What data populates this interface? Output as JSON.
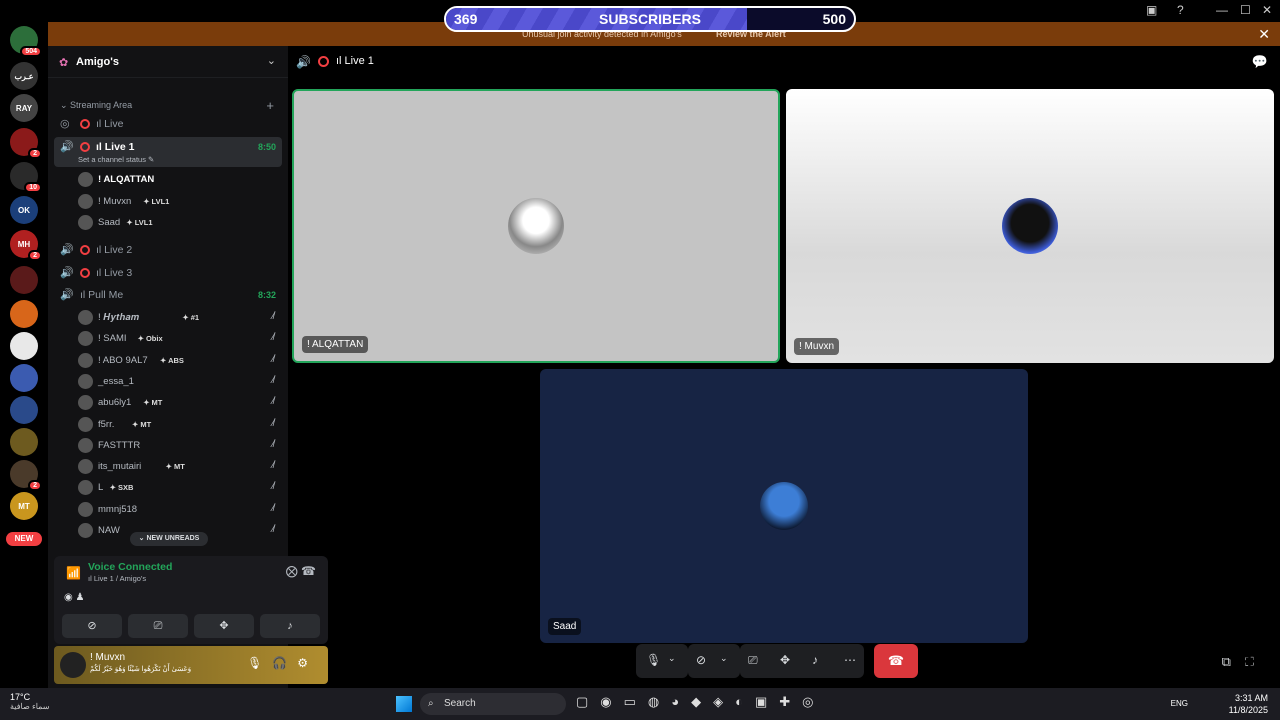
{
  "subscriber_bar": {
    "current": "369",
    "label": "SUBSCRIBERS",
    "goal": "500",
    "progress_fraction": 0.738
  },
  "alert": {
    "text": "Unusual join activity detected in Amigo's",
    "link": "Review the Alert"
  },
  "server_rail": {
    "top_badge": "504",
    "new_label": "NEW",
    "servers": [
      {
        "initials": "",
        "badge": "504"
      },
      {
        "initials": "عـرب",
        "badge": ""
      },
      {
        "initials": "RAY",
        "badge": ""
      },
      {
        "initials": "",
        "badge": "2"
      },
      {
        "initials": "",
        "badge": "10"
      },
      {
        "initials": "OK",
        "badge": ""
      },
      {
        "initials": "MH",
        "badge": "2"
      },
      {
        "initials": "",
        "badge": ""
      },
      {
        "initials": "",
        "badge": ""
      },
      {
        "initials": "",
        "badge": ""
      },
      {
        "initials": "",
        "badge": ""
      },
      {
        "initials": "",
        "badge": ""
      },
      {
        "initials": "",
        "badge": ""
      },
      {
        "initials": "",
        "badge": "2"
      },
      {
        "initials": "MT",
        "badge": ""
      }
    ]
  },
  "guild": {
    "name": "Amigo's",
    "category": "Streaming Area"
  },
  "channels": {
    "live": "ıl Live",
    "live1": "ıl Live 1",
    "live1_time": "8:50",
    "live1_status": "Set a channel status",
    "live2": "ıl Live 2",
    "live3": "ıl Live 3",
    "pull": "ıl Pull Me",
    "pull_time": "8:32"
  },
  "live1_users": [
    {
      "name": "! ALQATTAN",
      "tag": ""
    },
    {
      "name": "! Muvxn",
      "tag": "LVL1"
    },
    {
      "name": "Saad",
      "tag": "LVL1"
    }
  ],
  "pull_users": [
    {
      "name": "! 𝑯𝒚𝒕𝒉𝒂𝒎",
      "tag": "#1"
    },
    {
      "name": "! SAMI",
      "tag": "Obix"
    },
    {
      "name": "! ABO 9AL7",
      "tag": "ABS"
    },
    {
      "name": "_essa_1",
      "tag": ""
    },
    {
      "name": "abu6ly1",
      "tag": "MT"
    },
    {
      "name": "f5rr.",
      "tag": "MT"
    },
    {
      "name": "FASTTTR",
      "tag": ""
    },
    {
      "name": "its_mutairi",
      "tag": "MT"
    },
    {
      "name": "L",
      "tag": "SXB"
    },
    {
      "name": "mmnj518",
      "tag": ""
    },
    {
      "name": "NAW",
      "tag": ""
    }
  ],
  "new_unreads": "NEW UNREADS",
  "voice": {
    "title": "Voice Connected",
    "sub": "ıl Live 1 / Amigo's"
  },
  "user_panel": {
    "name": "! Muvxn",
    "status": "وَعَسَىٰ أَنْ تَكْرَهُوا شَيْئًا وَهُوَ خَيْرٌ لَكُمْ"
  },
  "stage": {
    "channel": "ıl Live 1"
  },
  "tiles": [
    {
      "label": "! ALQATTAN"
    },
    {
      "label": "! Muvxn"
    },
    {
      "label": "Saad"
    }
  ],
  "taskbar": {
    "temp": "17°C",
    "condition": "سماء صافية",
    "search": "Search",
    "lang": "ENG",
    "time": "3:31 AM",
    "date": "11/8/2025"
  },
  "colors": {
    "accent_green": "#23a55a",
    "danger": "#f23f42",
    "alert_bg": "#7a3c0b",
    "progress": "#5b59da"
  }
}
